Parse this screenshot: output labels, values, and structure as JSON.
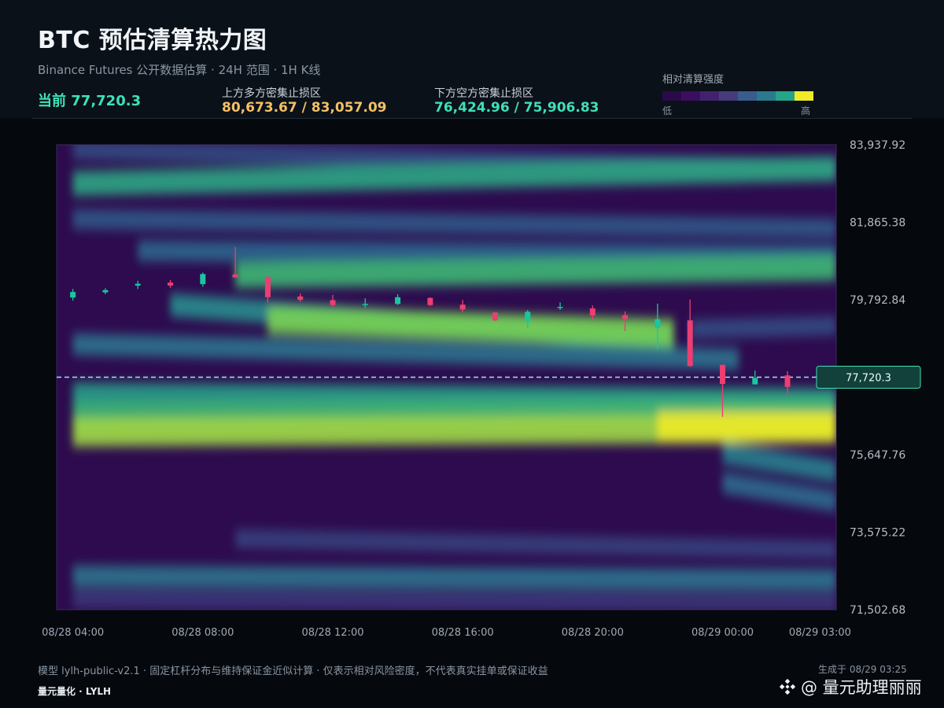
{
  "header": {
    "title": "BTC 预估清算热力图",
    "subtitle": "Binance Futures 公开数据估算 · 24H 范围 · 1H K线",
    "current_label": "当前 77,720.3",
    "upper_label": "上方多方密集止损区",
    "upper_value": "80,673.67 / 83,057.09",
    "lower_label": "下方空方密集止损区",
    "lower_value": "76,424.96 / 75,906.83",
    "legend_title": "相对清算强度",
    "legend_low": "低",
    "legend_high": "高"
  },
  "colors": {
    "background": "#05080d",
    "header_bg": "#0b1119",
    "accent_green": "#3ee0b8",
    "accent_orange": "#f5c065",
    "candle_up": "#19c6a0",
    "candle_down": "#ec3e72",
    "legend_scale": [
      "#2a0a4a",
      "#3b0f5e",
      "#42226e",
      "#463b7c",
      "#3a5c8c",
      "#2b7a8e",
      "#24a58a",
      "#f0ea28"
    ]
  },
  "chart_data": {
    "type": "heatmap",
    "title": "BTC 预估清算热力图",
    "xlabel": "",
    "ylabel": "",
    "ylim": [
      71502.68,
      83937.92
    ],
    "y_ticks": [
      "83,937.92",
      "81,865.38",
      "79,792.84",
      "77,720.3",
      "75,647.76",
      "73,575.22",
      "71,502.68"
    ],
    "y_tick_values": [
      83937.92,
      81865.38,
      79792.84,
      77720.3,
      75647.76,
      73575.22,
      71502.68
    ],
    "x_ticks": [
      "08/28 04:00",
      "08/28 08:00",
      "08/28 12:00",
      "08/28 16:00",
      "08/28 20:00",
      "08/29 00:00",
      "08/29 03:00"
    ],
    "x_tick_hours": [
      0,
      4,
      8,
      12,
      16,
      20,
      23
    ],
    "x_range_hours": [
      -0.5,
      23.5
    ],
    "current_price": 77720.3,
    "current_price_label": "77,720.3",
    "bands": [
      {
        "hours": [
          0,
          23.5
        ],
        "price_start": 83800,
        "price_end": 83300,
        "intensity": 0.3
      },
      {
        "hours": [
          0,
          23.5
        ],
        "price_start": 82900,
        "price_end": 83300,
        "intensity": 0.65
      },
      {
        "hours": [
          0,
          23.5
        ],
        "price_start": 81950,
        "price_end": 81700,
        "intensity": 0.35
      },
      {
        "hours": [
          2,
          23.5
        ],
        "price_start": 81100,
        "price_end": 81000,
        "intensity": 0.4
      },
      {
        "hours": [
          5,
          23.5
        ],
        "price_start": 80450,
        "price_end": 80650,
        "intensity": 0.72
      },
      {
        "hours": [
          3,
          18.5
        ],
        "price_start": 79650,
        "price_end": 78700,
        "intensity": 0.55
      },
      {
        "hours": [
          6,
          18.5
        ],
        "price_start": 79250,
        "price_end": 78900,
        "intensity": 0.85
      },
      {
        "hours": [
          0,
          20.5
        ],
        "price_start": 78600,
        "price_end": 78200,
        "intensity": 0.45
      },
      {
        "hours": [
          19,
          23.5
        ],
        "price_start": 79000,
        "price_end": 79100,
        "intensity": 0.3
      },
      {
        "hours": [
          0,
          23.5
        ],
        "price_start": 77250,
        "price_end": 77100,
        "intensity": 0.62
      },
      {
        "hours": [
          0,
          23.5
        ],
        "price_start": 76700,
        "price_end": 76850,
        "intensity": 0.72
      },
      {
        "hours": [
          0,
          23.5
        ],
        "price_start": 76250,
        "price_end": 76350,
        "intensity": 0.9
      },
      {
        "hours": [
          18,
          23.5
        ],
        "price_start": 76400,
        "price_end": 76400,
        "intensity": 1.0
      },
      {
        "hours": [
          20,
          23.5
        ],
        "price_start": 75700,
        "price_end": 75200,
        "intensity": 0.5
      },
      {
        "hours": [
          20,
          23.5
        ],
        "price_start": 74900,
        "price_end": 74400,
        "intensity": 0.42
      },
      {
        "hours": [
          5,
          23.5
        ],
        "price_start": 73400,
        "price_end": 73100,
        "intensity": 0.25
      },
      {
        "hours": [
          0,
          23.5
        ],
        "price_start": 72400,
        "price_end": 72300,
        "intensity": 0.45
      },
      {
        "hours": [
          0,
          23.5
        ],
        "price_start": 71800,
        "price_end": 71700,
        "intensity": 0.22
      }
    ],
    "candles": [
      {
        "hour": 0,
        "open": 79850,
        "high": 80080,
        "low": 79770,
        "close": 80000
      },
      {
        "hour": 1,
        "open": 79990,
        "high": 80100,
        "low": 79940,
        "close": 80050
      },
      {
        "hour": 2,
        "open": 80170,
        "high": 80300,
        "low": 80080,
        "close": 80220
      },
      {
        "hour": 3,
        "open": 80250,
        "high": 80320,
        "low": 80110,
        "close": 80170
      },
      {
        "hour": 4,
        "open": 80210,
        "high": 80520,
        "low": 80140,
        "close": 80480
      },
      {
        "hour": 5,
        "open": 80470,
        "high": 81200,
        "low": 80390,
        "close": 80390
      },
      {
        "hour": 6,
        "open": 80410,
        "high": 80410,
        "low": 79720,
        "close": 79860
      },
      {
        "hour": 7,
        "open": 79880,
        "high": 79960,
        "low": 79740,
        "close": 79790
      },
      {
        "hour": 8,
        "open": 79780,
        "high": 79920,
        "low": 79610,
        "close": 79650
      },
      {
        "hour": 9,
        "open": 79650,
        "high": 79830,
        "low": 79580,
        "close": 79680
      },
      {
        "hour": 10,
        "open": 79680,
        "high": 79940,
        "low": 79650,
        "close": 79860
      },
      {
        "hour": 11,
        "open": 79840,
        "high": 79860,
        "low": 79620,
        "close": 79650
      },
      {
        "hour": 12,
        "open": 79660,
        "high": 79790,
        "low": 79460,
        "close": 79530
      },
      {
        "hour": 13,
        "open": 79450,
        "high": 79460,
        "low": 79220,
        "close": 79240
      },
      {
        "hour": 14,
        "open": 79220,
        "high": 79520,
        "low": 79030,
        "close": 79470
      },
      {
        "hour": 15,
        "open": 79590,
        "high": 79720,
        "low": 79520,
        "close": 79600
      },
      {
        "hour": 16,
        "open": 79560,
        "high": 79640,
        "low": 79270,
        "close": 79370
      },
      {
        "hour": 17,
        "open": 79380,
        "high": 79480,
        "low": 78950,
        "close": 79280
      },
      {
        "hour": 18,
        "open": 79040,
        "high": 79690,
        "low": 78460,
        "close": 79270
      },
      {
        "hour": 19,
        "open": 79240,
        "high": 79800,
        "low": 78000,
        "close": 78020
      },
      {
        "hour": 20,
        "open": 78050,
        "high": 78060,
        "low": 76660,
        "close": 77540
      },
      {
        "hour": 21,
        "open": 77530,
        "high": 77900,
        "low": 77520,
        "close": 77700
      },
      {
        "hour": 22,
        "open": 77770,
        "high": 77880,
        "low": 77240,
        "close": 77460
      }
    ]
  },
  "footer": {
    "note": "模型 lylh-public-v2.1 · 固定杠杆分布与维持保证金近似计算 · 仅表示相对风险密度，不代表真实挂单或保证收益",
    "generated": "生成于 08/29 03:25",
    "brand": "量元量化 · LYLH",
    "watermark": "@ 量元助理丽丽"
  }
}
